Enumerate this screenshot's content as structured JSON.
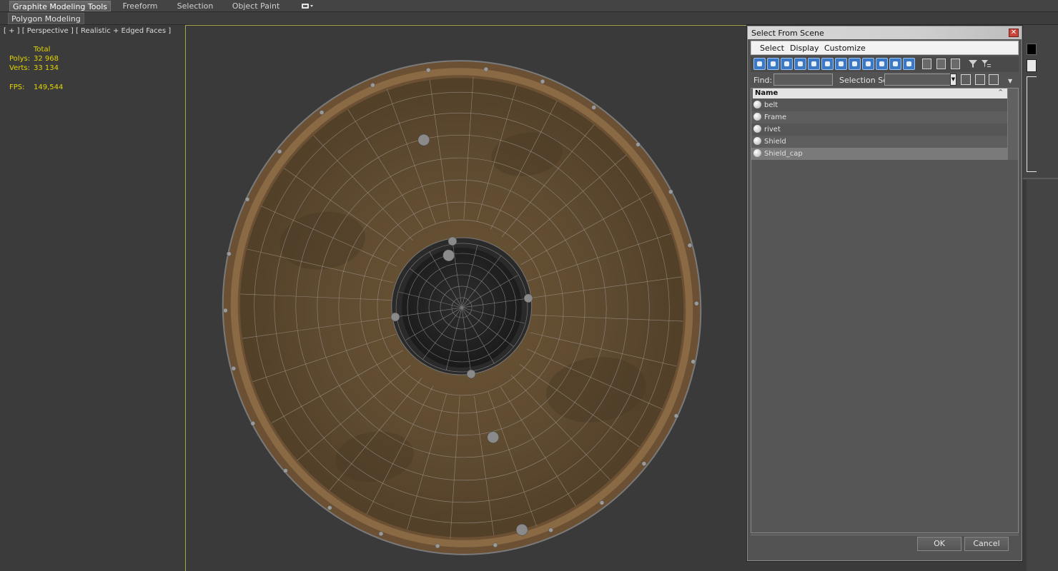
{
  "ribbon": {
    "tabs": [
      "Graphite Modeling Tools",
      "Freeform",
      "Selection",
      "Object Paint"
    ],
    "active_tab": "Graphite Modeling Tools",
    "sub_button": "Polygon Modeling"
  },
  "viewport": {
    "label": "[ + ] [ Perspective ] [ Realistic + Edged Faces ]",
    "stats": {
      "header": "Total",
      "polys_label": "Polys:",
      "polys_value": "32 968",
      "verts_label": "Verts:",
      "verts_value": "33 134",
      "fps_label": "FPS:",
      "fps_value": "149,544"
    }
  },
  "dialog": {
    "title": "Select From Scene",
    "menu": [
      "Select",
      "Display",
      "Customize"
    ],
    "find_label": "Find:",
    "find_value": "",
    "selection_set_label": "Selection Set:",
    "selection_set_value": "",
    "column_header": "Name",
    "objects": [
      {
        "name": "belt",
        "selected": false
      },
      {
        "name": "Frame",
        "selected": false
      },
      {
        "name": "rivet",
        "selected": false
      },
      {
        "name": "Shield",
        "selected": false
      },
      {
        "name": "Shield_cap",
        "selected": true
      }
    ],
    "ok_label": "OK",
    "cancel_label": "Cancel"
  },
  "colors": {
    "stats_text": "#e3d400",
    "viewport_border": "#a6a64a",
    "toolbar_button": "#3b78c6",
    "close_button": "#c8453a"
  }
}
